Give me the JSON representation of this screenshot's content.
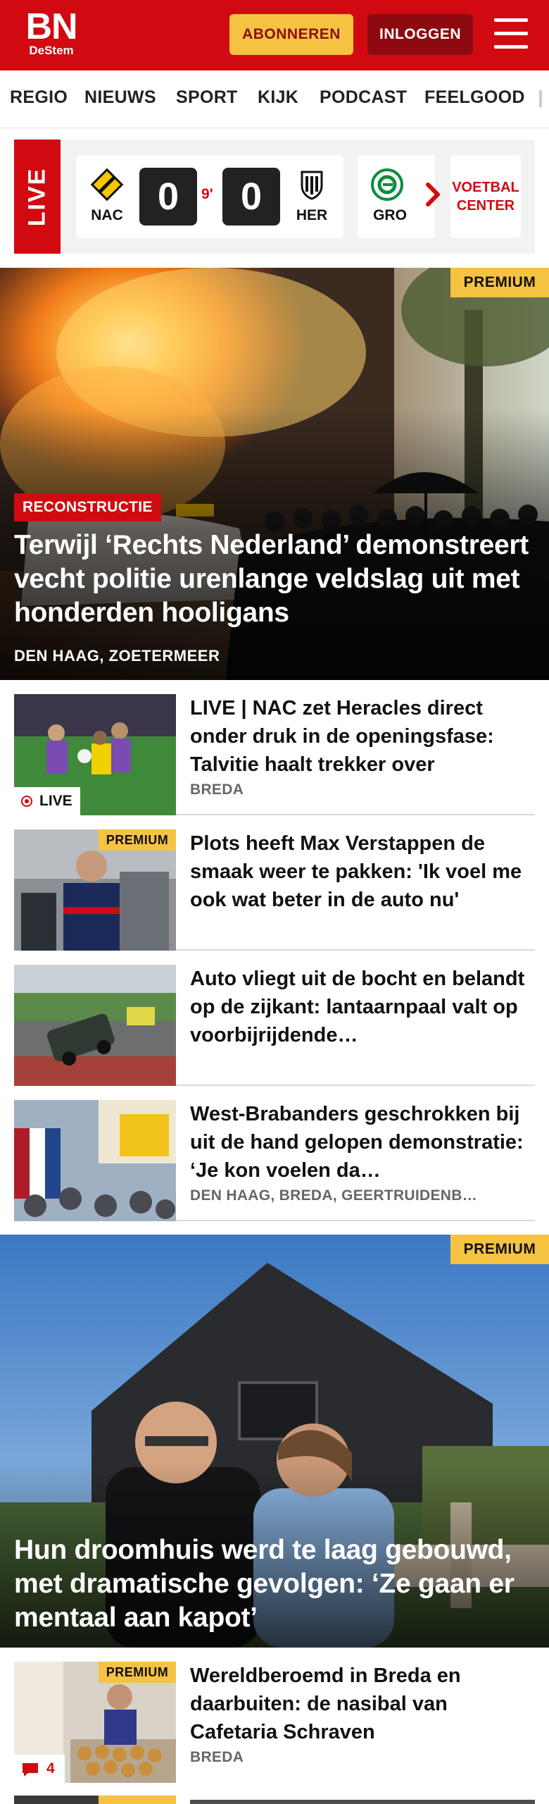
{
  "header": {
    "logo_main": "BN",
    "logo_sub": "DeStem",
    "subscribe_label": "ABONNEREN",
    "login_label": "INLOGGEN",
    "brand_color": "#d10a11",
    "accent_color": "#f5c242"
  },
  "nav": {
    "items": [
      "REGIO",
      "NIEUWS",
      "SPORT",
      "KIJK",
      "PODCAST",
      "FEELGOOD"
    ]
  },
  "live": {
    "label": "LIVE",
    "match": {
      "home_short": "NAC",
      "away_short": "HER",
      "home_score": "0",
      "away_score": "0",
      "minute": "9'"
    },
    "next_team_short": "GRO",
    "voetbal_center_line1": "VOETBAL",
    "voetbal_center_line2": "CENTER"
  },
  "hero": {
    "premium_label": "PREMIUM",
    "tag": "RECONSTRUCTIE",
    "title": "Terwijl ‘Rechts Nederland’ demon­streert vecht politie urenlange veldslag uit met honderden hooligans",
    "location": "DEN HAAG, ZOETERMEER"
  },
  "articles": [
    {
      "title": "LIVE | NAC zet Heracles direct onder druk in de openingsfase: Talvitie haalt trekker over",
      "location": "BREDA",
      "badge": "LIVE"
    },
    {
      "title": "Plots heeft Max Verstappen de smaak weer te pakken: 'Ik voel me ook wat beter in de auto nu'",
      "premium_label": "PREMIUM"
    },
    {
      "title": "Auto vliegt uit de bocht en belandt op de zijkant: lantaarn­paal valt op voorbijrijdende…"
    },
    {
      "title": "West-Brabanders geschrokken bij uit de hand gelopen demonstratie: ‘Je kon voelen da…",
      "location": "DEN HAAG, BREDA, GEERTRUIDENB…"
    }
  ],
  "feature": {
    "premium_label": "PREMIUM",
    "title": "Hun droomhuis werd te laag gebouwd, met dramatische gevolgen: ‘Ze gaan er mentaal aan kapot’"
  },
  "article_bottom": {
    "premium_label": "PREMIUM",
    "title": "Wereldberoemd in Breda en daarbuiten: de nasibal van Cafetaria Schraven",
    "location": "BREDA",
    "comments": "4"
  },
  "icons": {
    "menu": "hamburger-icon",
    "chevron": "chevron-right-icon",
    "comment": "comment-icon",
    "live": "live-dot-icon"
  }
}
